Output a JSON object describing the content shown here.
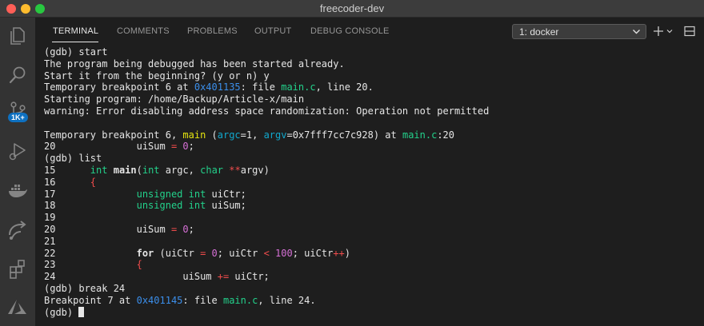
{
  "window": {
    "title": "freecoder-dev"
  },
  "activity_bar": {
    "items": [
      {
        "name": "explorer-icon"
      },
      {
        "name": "search-icon"
      },
      {
        "name": "source-control-icon",
        "badge": "1K+"
      },
      {
        "name": "run-debug-icon"
      },
      {
        "name": "docker-icon"
      },
      {
        "name": "remote-explorer-icon"
      },
      {
        "name": "extensions-icon"
      },
      {
        "name": "azure-icon"
      }
    ]
  },
  "panel": {
    "tabs": [
      {
        "label": "TERMINAL",
        "active": true
      },
      {
        "label": "COMMENTS"
      },
      {
        "label": "PROBLEMS"
      },
      {
        "label": "OUTPUT"
      },
      {
        "label": "DEBUG CONSOLE"
      }
    ],
    "terminal_select": "1: docker",
    "toolbar_icons": [
      "plus-icon",
      "chevron-down-icon",
      "split-terminal-icon"
    ]
  },
  "colors": {
    "blue": "#3b8eea",
    "yellow": "#e5e510",
    "cyan": "#11a8cd",
    "green": "#23d18b",
    "red": "#f14c4c",
    "magenta": "#d670d6"
  },
  "terminal": {
    "lines": [
      [
        {
          "t": "(gdb) start"
        }
      ],
      [
        {
          "t": "The program being debugged has been started already."
        }
      ],
      [
        {
          "t": "Start it from the beginning? (y or n) y"
        }
      ],
      [
        {
          "t": "Temporary breakpoint 6 at "
        },
        {
          "t": "0x401135",
          "c": "blue"
        },
        {
          "t": ": file "
        },
        {
          "t": "main.c",
          "c": "green"
        },
        {
          "t": ", line 20."
        }
      ],
      [
        {
          "t": "Starting program: /home/Backup/Article-x/main"
        }
      ],
      [
        {
          "t": "warning: Error disabling address space randomization: Operation not permitted"
        }
      ],
      [
        {
          "t": ""
        }
      ],
      [
        {
          "t": "Temporary breakpoint 6, "
        },
        {
          "t": "main",
          "c": "yellow"
        },
        {
          "t": " ("
        },
        {
          "t": "argc",
          "c": "cyan"
        },
        {
          "t": "=1, "
        },
        {
          "t": "argv",
          "c": "cyan"
        },
        {
          "t": "=0x7fff7cc7c928) at "
        },
        {
          "t": "main.c",
          "c": "green"
        },
        {
          "t": ":20"
        }
      ],
      [
        {
          "t": "20              uiSum "
        },
        {
          "t": "=",
          "c": "red"
        },
        {
          "t": " "
        },
        {
          "t": "0",
          "c": "magenta"
        },
        {
          "t": ";"
        }
      ],
      [
        {
          "t": "(gdb) list"
        }
      ],
      [
        {
          "t": "15      "
        },
        {
          "t": "int",
          "c": "green"
        },
        {
          "t": " "
        },
        {
          "t": "main",
          "c": "bold"
        },
        {
          "t": "("
        },
        {
          "t": "int",
          "c": "green"
        },
        {
          "t": " argc, "
        },
        {
          "t": "char",
          "c": "green"
        },
        {
          "t": " "
        },
        {
          "t": "**",
          "c": "red"
        },
        {
          "t": "argv)"
        }
      ],
      [
        {
          "t": "16      "
        },
        {
          "t": "{",
          "c": "red"
        }
      ],
      [
        {
          "t": "17              "
        },
        {
          "t": "unsigned int",
          "c": "green"
        },
        {
          "t": " uiCtr;"
        }
      ],
      [
        {
          "t": "18              "
        },
        {
          "t": "unsigned int",
          "c": "green"
        },
        {
          "t": " uiSum;"
        }
      ],
      [
        {
          "t": "19"
        }
      ],
      [
        {
          "t": "20              uiSum "
        },
        {
          "t": "=",
          "c": "red"
        },
        {
          "t": " "
        },
        {
          "t": "0",
          "c": "magenta"
        },
        {
          "t": ";"
        }
      ],
      [
        {
          "t": "21"
        }
      ],
      [
        {
          "t": "22              "
        },
        {
          "t": "for",
          "c": "bold"
        },
        {
          "t": " (uiCtr "
        },
        {
          "t": "=",
          "c": "red"
        },
        {
          "t": " "
        },
        {
          "t": "0",
          "c": "magenta"
        },
        {
          "t": "; uiCtr "
        },
        {
          "t": "<",
          "c": "red"
        },
        {
          "t": " "
        },
        {
          "t": "100",
          "c": "magenta"
        },
        {
          "t": "; uiCtr"
        },
        {
          "t": "++",
          "c": "red"
        },
        {
          "t": ")"
        }
      ],
      [
        {
          "t": "23              "
        },
        {
          "t": "{",
          "c": "red"
        }
      ],
      [
        {
          "t": "24                      uiSum "
        },
        {
          "t": "+=",
          "c": "red"
        },
        {
          "t": " uiCtr;"
        }
      ],
      [
        {
          "t": "(gdb) break 24"
        }
      ],
      [
        {
          "t": "Breakpoint 7 at "
        },
        {
          "t": "0x401145",
          "c": "blue"
        },
        {
          "t": ": file "
        },
        {
          "t": "main.c",
          "c": "green"
        },
        {
          "t": ", line 24."
        }
      ],
      [
        {
          "t": "(gdb) "
        },
        {
          "cursor": true
        }
      ]
    ]
  }
}
